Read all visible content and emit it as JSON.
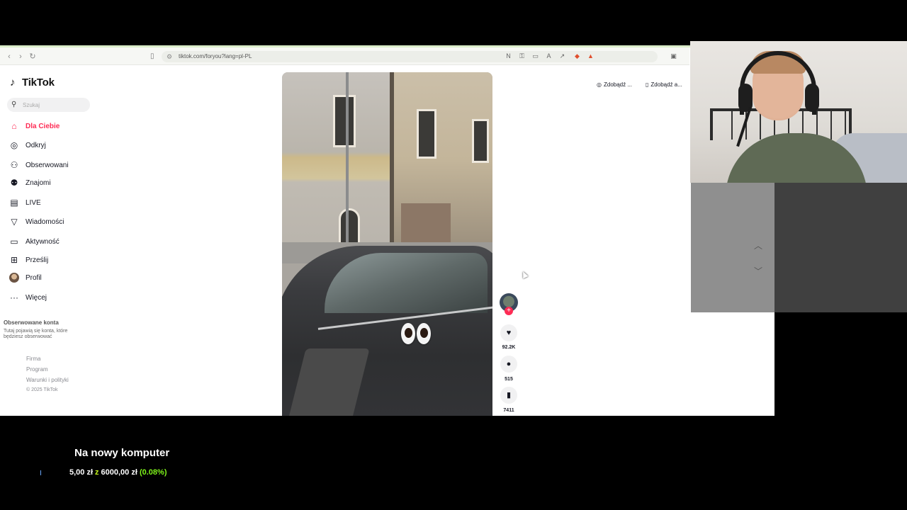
{
  "browser": {
    "url": "tiktok.com/foryou?lang=pl-PL"
  },
  "sidebar": {
    "logo": "TikTok",
    "search_placeholder": "Szukaj",
    "items": [
      {
        "label": "Dla Ciebie",
        "icon": "home-icon",
        "active": true
      },
      {
        "label": "Odkryj",
        "icon": "compass-icon"
      },
      {
        "label": "Obserwowani",
        "icon": "user-follow-icon"
      },
      {
        "label": "Znajomi",
        "icon": "friends-icon"
      },
      {
        "label": "LIVE",
        "icon": "live-tv-icon"
      },
      {
        "label": "Wiadomości",
        "icon": "send-icon"
      },
      {
        "label": "Aktywność",
        "icon": "activity-icon"
      },
      {
        "label": "Prześlij",
        "icon": "upload-icon"
      },
      {
        "label": "Profil",
        "icon": "avatar"
      },
      {
        "label": "Więcej",
        "icon": "more-icon"
      }
    ],
    "following_title": "Obserwowane konta",
    "following_desc": "Tutaj pojawią się konta, które będziesz obserwować",
    "footer": [
      "Firma",
      "Program",
      "Warunki i polityki"
    ],
    "copyright": "© 2025 TikTok"
  },
  "header": {
    "link1": "Zdobądź ...",
    "link2": "Zdobądź a..."
  },
  "actions": {
    "likes": "92.2K",
    "comments": "515",
    "saves": "7411"
  },
  "donation": {
    "title": "Na nowy komputer",
    "current": "5,00 zł",
    "separator": "z",
    "goal": "6000,00 zł",
    "percent": "(0.08%)"
  }
}
